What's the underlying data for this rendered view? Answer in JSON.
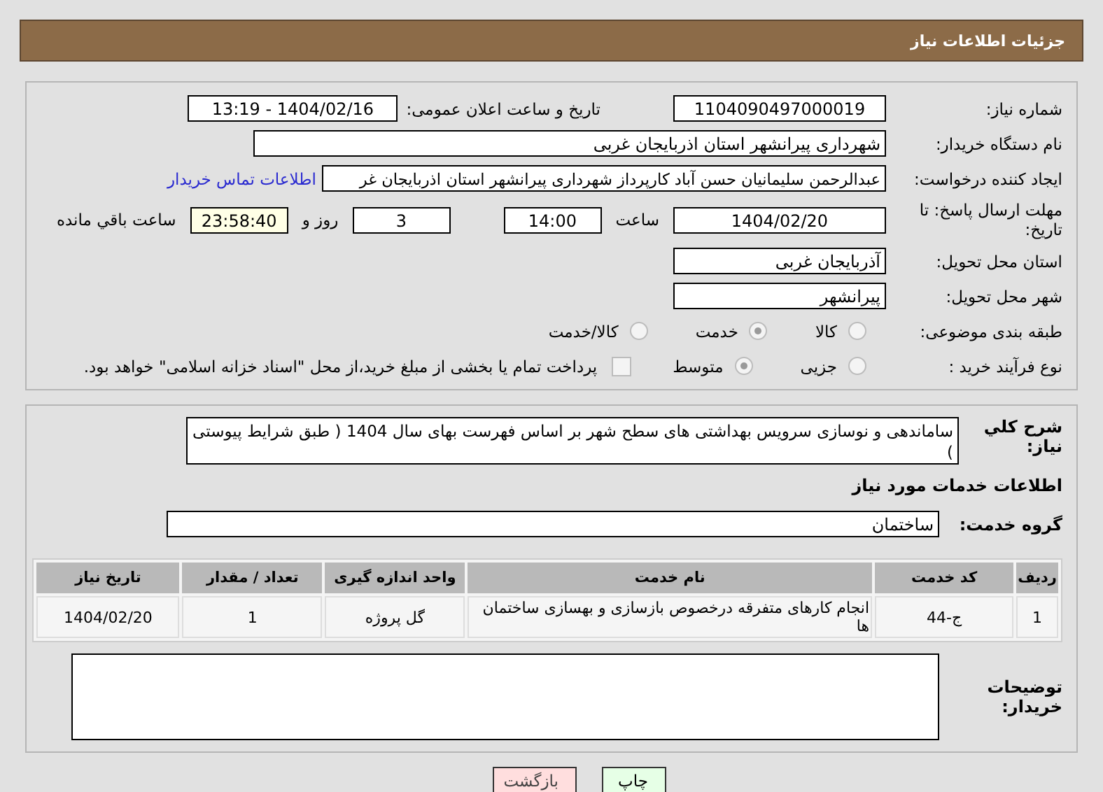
{
  "header": {
    "title": "جزئیات اطلاعات نیاز"
  },
  "need_info": {
    "need_number": {
      "label": "شماره نیاز:",
      "value": "1104090497000019"
    },
    "announce": {
      "label": "تاریخ و ساعت اعلان عمومی:",
      "value": "1404/02/16 - 13:19"
    },
    "buyer_org": {
      "label": "نام دستگاه خریدار:",
      "value": "شهرداری پیرانشهر استان اذربایجان غربی"
    },
    "requester": {
      "label": "ایجاد کننده درخواست:",
      "value": "عبدالرحمن سلیمانیان حسن آباد کارپرداز شهرداری پیرانشهر استان اذربایجان غر",
      "link": "اطلاعات تماس خریدار"
    },
    "deadline": {
      "label": "مهلت ارسال پاسخ: تا تاریخ:",
      "date": "1404/02/20",
      "time_label": "ساعت",
      "time": "14:00",
      "days": "3",
      "days_label": "روز و",
      "remaining": "23:58:40",
      "remaining_label": "ساعت باقي مانده"
    },
    "province": {
      "label": "استان محل تحویل:",
      "value": "آذربایجان غربی"
    },
    "city": {
      "label": "شهر محل تحویل:",
      "value": "پیرانشهر"
    },
    "category": {
      "label": "طبقه بندی موضوعی:",
      "options": [
        {
          "label": "کالا",
          "selected": false
        },
        {
          "label": "خدمت",
          "selected": true
        },
        {
          "label": "کالا/خدمت",
          "selected": false
        }
      ]
    },
    "process": {
      "label": "نوع فرآیند خرید :",
      "options": [
        {
          "label": "جزیی",
          "selected": false
        },
        {
          "label": "متوسط",
          "selected": true
        }
      ],
      "payment": {
        "checked": false,
        "text": "پرداخت تمام یا بخشی از مبلغ خرید،از محل \"اسناد خزانه اسلامی\" خواهد بود."
      }
    }
  },
  "services": {
    "description": {
      "label": "شرح کلي نیاز:",
      "value": "ساماندهی و نوسازی سرویس بهداشتی های سطح شهر بر اساس فهرست بهای سال 1404 ( طبق شرایط پیوستی )"
    },
    "section_title": "اطلاعات خدمات مورد نیاز",
    "group": {
      "label": "گروه خدمت:",
      "value": "ساختمان"
    },
    "table": {
      "columns": [
        "ردیف",
        "کد خدمت",
        "نام خدمت",
        "واحد اندازه گیری",
        "تعداد / مقدار",
        "تاریخ نیاز"
      ],
      "rows": [
        [
          "1",
          "ج-44",
          "انجام کارهای متفرقه درخصوص بازسازی و بهسازی ساختمان ها",
          "گل پروژه",
          "1",
          "1404/02/20"
        ]
      ]
    },
    "notes": {
      "label": "توضیحات خریدار:"
    }
  },
  "buttons": [
    {
      "label": "چاپ",
      "kind": "print"
    },
    {
      "label": "بازگشت",
      "kind": "back"
    }
  ]
}
